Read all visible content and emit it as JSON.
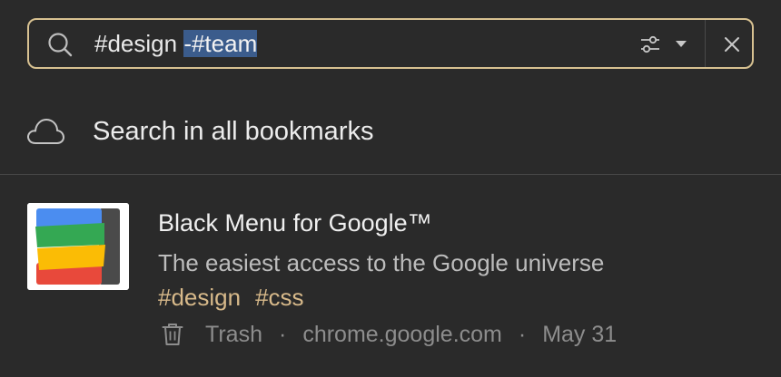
{
  "search": {
    "query_plain": "#design ",
    "query_selected": "-#team"
  },
  "all_bookmarks": {
    "label": "Search in all bookmarks"
  },
  "bookmark": {
    "title": "Black Menu for Google™",
    "description": "The easiest access to the Google universe",
    "tags": [
      "#design",
      "#css"
    ],
    "collection": "Trash",
    "separator": "·",
    "domain": "chrome.google.com",
    "date": "May 31"
  },
  "colors": {
    "background": "#2a2a2a",
    "search_border": "#d7c191",
    "selection": "#3b5c8c",
    "tag": "#d7b98a"
  },
  "icons": {
    "search": "search-icon",
    "filter": "filter-icon",
    "dropdown": "chevron-down-icon",
    "close": "close-icon",
    "cloud": "cloud-icon",
    "trash": "trash-icon"
  }
}
